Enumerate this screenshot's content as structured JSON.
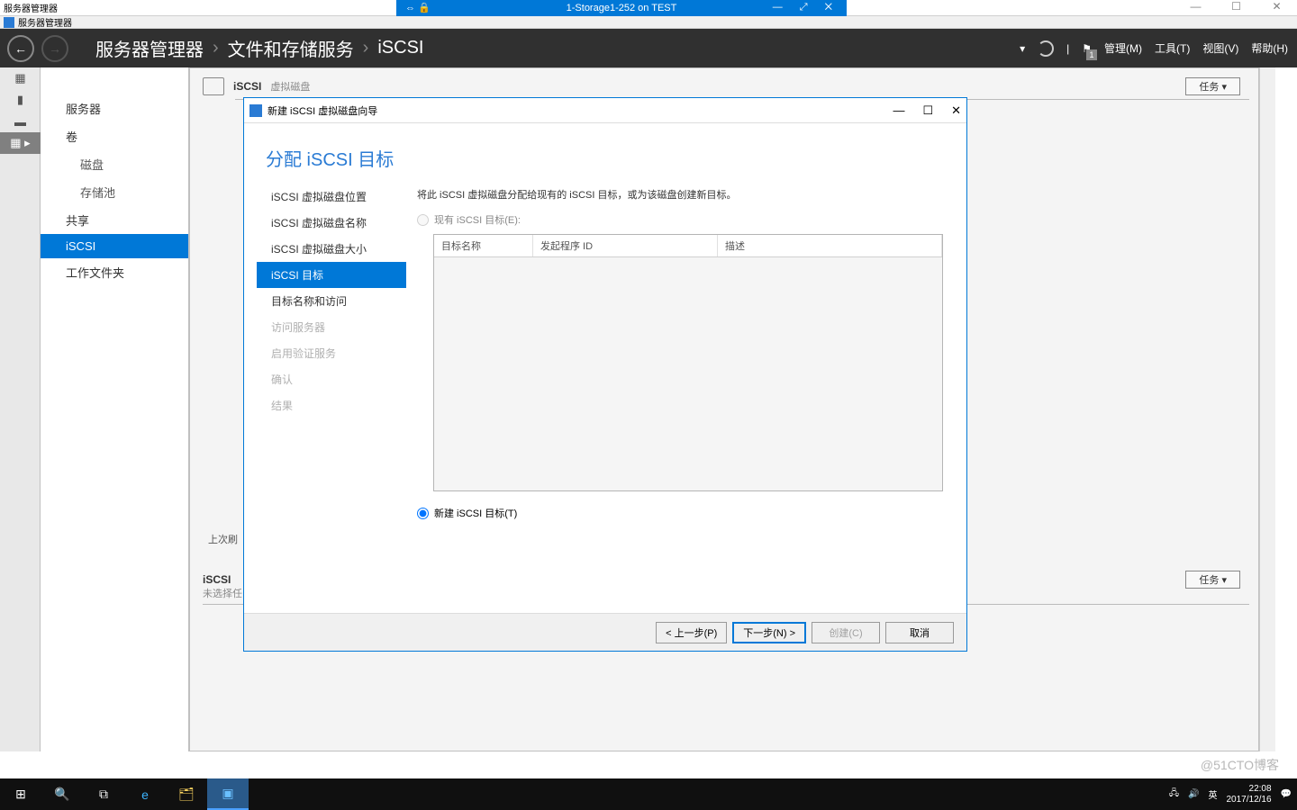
{
  "outer_window": {
    "left_title": "服务器管理器",
    "vm_title": "1-Storage1-252 on TEST",
    "vm_controls": "— ⤢ ✕",
    "pin": "⇔ 🔒",
    "min": "—",
    "max": "☐",
    "close": "✕"
  },
  "sm_window": {
    "title": "服务器管理器"
  },
  "breadcrumb": {
    "a": "服务器管理器",
    "b": "文件和存储服务",
    "c": "iSCSI",
    "sep": "›"
  },
  "header_menu": {
    "manage": "管理(M)",
    "tools": "工具(T)",
    "view": "视图(V)",
    "help": "帮助(H)",
    "flag_count": "1",
    "dropdown": "▾",
    "pipe": "|"
  },
  "sidebar": {
    "items": [
      "服务器",
      "卷",
      "磁盘",
      "存储池",
      "共享",
      "iSCSI",
      "工作文件夹"
    ]
  },
  "main": {
    "sec1_title": "iSCSI",
    "sec1_sub": "虚拟磁盘",
    "tasks": "任务  ▾",
    "lastref": "上次刷",
    "sec2_title": "iSCSI",
    "sec2_sub": "未选择任"
  },
  "wizard": {
    "title": "新建 iSCSI 虚拟磁盘向导",
    "heading": "分配 iSCSI 目标",
    "nav": [
      "iSCSI 虚拟磁盘位置",
      "iSCSI 虚拟磁盘名称",
      "iSCSI 虚拟磁盘大小",
      "iSCSI 目标",
      "目标名称和访问",
      "访问服务器",
      "启用验证服务",
      "确认",
      "结果"
    ],
    "intro": "将此 iSCSI 虚拟磁盘分配给现有的 iSCSI 目标，或为该磁盘创建新目标。",
    "radio_existing": "现有 iSCSI 目标(E):",
    "radio_new": "新建 iSCSI 目标(T)",
    "cols": {
      "c1": "目标名称",
      "c2": "发起程序 ID",
      "c3": "描述"
    },
    "btn_prev": "< 上一步(P)",
    "btn_next": "下一步(N) >",
    "btn_create": "创建(C)",
    "btn_cancel": "取消",
    "min": "—",
    "max": "☐",
    "close": "✕"
  },
  "taskbar": {
    "start": "⊞",
    "time": "22:08",
    "date": "2017/12/16",
    "ime": "英",
    "watermark": "@51CTO博客"
  }
}
